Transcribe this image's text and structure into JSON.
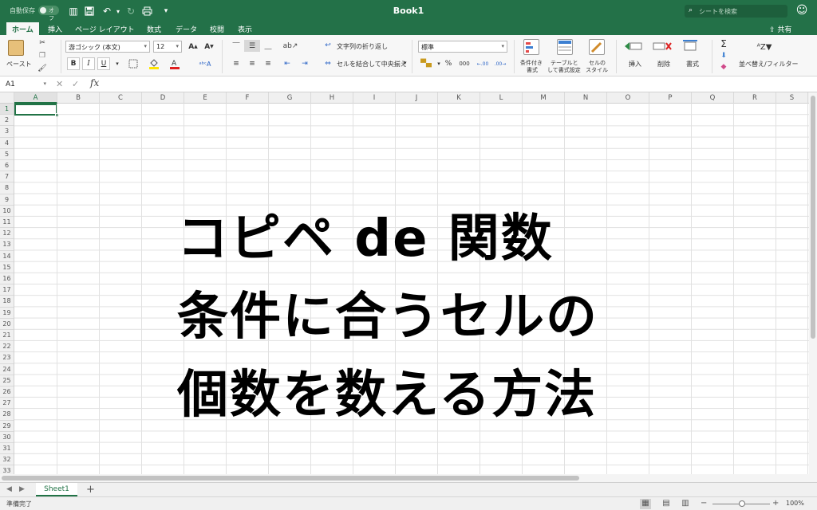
{
  "titlebar": {
    "autosave_label": "自動保存",
    "autosave_state": "オフ",
    "title": "Book1",
    "search_placeholder": "シートを検索"
  },
  "tabs": [
    "ホーム",
    "挿入",
    "ページ レイアウト",
    "数式",
    "データ",
    "校閲",
    "表示"
  ],
  "share_label": "共有",
  "ribbon": {
    "paste_label": "ペースト",
    "font_name": "游ゴシック (本文)",
    "font_size": "12",
    "bold": "B",
    "italic": "I",
    "underline": "U",
    "wrap_text": "文字列の折り返し",
    "merge_center": "セルを結合して中央揃え",
    "number_format": "標準",
    "percent": "%",
    "comma": "000",
    "cond_format_1": "条件付き",
    "cond_format_2": "書式",
    "table_1": "テーブルと",
    "table_2": "して書式設定",
    "cell_style_1": "セルの",
    "cell_style_2": "スタイル",
    "insert": "挿入",
    "delete": "削除",
    "format": "書式",
    "sort_filter": "並べ替え/フィルター",
    "accent": "#237148"
  },
  "formula_bar": {
    "name_box": "A1",
    "fx": "fx",
    "value": ""
  },
  "columns": [
    "A",
    "B",
    "C",
    "D",
    "E",
    "F",
    "G",
    "H",
    "I",
    "J",
    "K",
    "L",
    "M",
    "N",
    "O",
    "P",
    "Q",
    "R",
    "S"
  ],
  "rows": [
    "1",
    "2",
    "3",
    "4",
    "5",
    "6",
    "7",
    "8",
    "9",
    "10",
    "11",
    "12",
    "13",
    "14",
    "15",
    "16",
    "17",
    "18",
    "19",
    "20",
    "21",
    "22",
    "23",
    "24",
    "25",
    "26",
    "27",
    "28",
    "29",
    "30",
    "31",
    "32",
    "33"
  ],
  "overlay": {
    "line1": "コピペ de 関数",
    "line2": "条件に合うセルの",
    "line3": "個数を数える方法"
  },
  "sheet_tab": "Sheet1",
  "status": {
    "text": "準備完了",
    "zoom": "100%"
  }
}
